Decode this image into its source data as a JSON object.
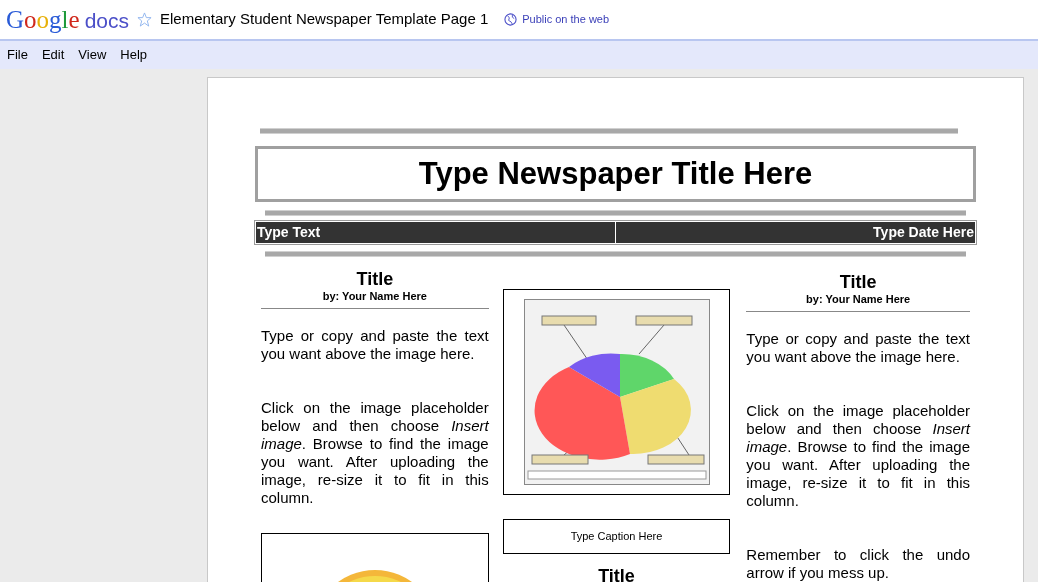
{
  "app": {
    "logo": "Google",
    "product": "docs"
  },
  "document": {
    "title": "Elementary Student Newspaper Template Page 1",
    "starred": false,
    "sharing": "Public on the web"
  },
  "menu": [
    "File",
    "Edit",
    "View",
    "Help"
  ],
  "newspaper": {
    "title": "Type Newspaper Title Here",
    "info_bar": [
      "Type Text",
      "Type Date Here"
    ],
    "columns": [
      {
        "items": [
          {
            "kind": "heading",
            "text": "Title"
          },
          {
            "kind": "byline",
            "text": "by: Your Name Here"
          },
          {
            "kind": "paragraph",
            "text": "Type or copy and paste the text you want above the image here."
          },
          {
            "kind": "paragraph",
            "text": "Click on the image placeholder below and then choose *Insert image*. Browse to find the image you want. After uploading the image, re-size it to fit in this column."
          },
          {
            "kind": "picture"
          }
        ]
      },
      {
        "items": [
          {
            "kind": "chart"
          },
          {
            "kind": "caption",
            "text": "Type Caption Here"
          },
          {
            "kind": "heading",
            "text": "Title"
          }
        ]
      },
      {
        "items": [
          {
            "kind": "heading",
            "text": "Title"
          },
          {
            "kind": "byline",
            "text": "by: Your Name Here"
          },
          {
            "kind": "paragraph",
            "text": "Type or copy and paste the text you want above the image here."
          },
          {
            "kind": "paragraph",
            "text": "Click on the image placeholder below and then choose *Insert image*. Browse to find the image you want. After uploading the image, re-size it to fit in this column."
          },
          {
            "kind": "paragraph",
            "text": "Remember to click the undo arrow if you mess up."
          }
        ]
      }
    ]
  }
}
